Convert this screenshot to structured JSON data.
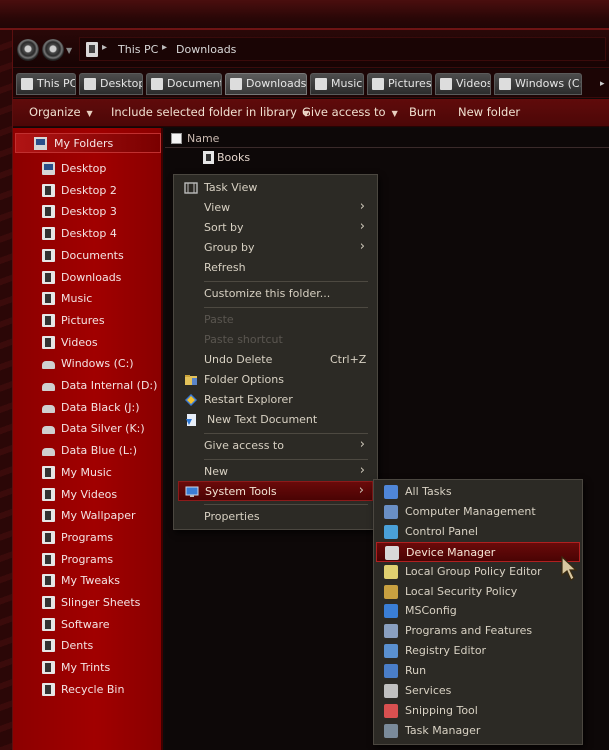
{
  "address": {
    "crumbs": [
      "This PC",
      "Downloads"
    ],
    "separator": "▸"
  },
  "tabs": [
    {
      "label": "This PC",
      "icon": "pc-icon"
    },
    {
      "label": "Desktop",
      "icon": "desktop-icon"
    },
    {
      "label": "Documents",
      "icon": "documents-icon"
    },
    {
      "label": "Downloads",
      "icon": "downloads-icon"
    },
    {
      "label": "Music",
      "icon": "music-icon"
    },
    {
      "label": "Pictures",
      "icon": "pictures-icon"
    },
    {
      "label": "Videos",
      "icon": "videos-icon"
    },
    {
      "label": "Windows (C:)",
      "icon": "drive-icon"
    }
  ],
  "tabs_more": "▸",
  "commands": {
    "organize": "Organize",
    "include": "Include selected folder in library",
    "give_access": "Give access to",
    "burn": "Burn",
    "new_folder": "New folder",
    "caret": "▼"
  },
  "nav": {
    "header": "My Folders",
    "items": [
      "Desktop",
      "Desktop 2",
      "Desktop 3",
      "Desktop 4",
      "Documents",
      "Downloads",
      "Music",
      "Pictures",
      "Videos",
      "Windows (C:)",
      "Data Internal (D:)",
      "Data Black (J:)",
      "Data Silver (K:)",
      "Data Blue (L:)",
      "My Music",
      "My Videos",
      "My Wallpaper",
      "Programs",
      "Programs",
      "My Tweaks",
      "Slinger Sheets",
      "Software",
      "Dents",
      "My Trints",
      "Recycle Bin"
    ]
  },
  "content": {
    "column_name": "Name",
    "files": [
      "Books"
    ]
  },
  "context_menu": {
    "task_view": "Task View",
    "view": "View",
    "sort_by": "Sort by",
    "group_by": "Group by",
    "refresh": "Refresh",
    "customize": "Customize this folder...",
    "paste": "Paste",
    "paste_shortcut": "Paste shortcut",
    "undo_delete": "Undo Delete",
    "undo_accel": "Ctrl+Z",
    "folder_options": "Folder Options",
    "restart_explorer": "Restart Explorer",
    "new_text_doc": "New Text Document",
    "give_access": "Give access to",
    "new": "New",
    "system_tools": "System Tools",
    "properties": "Properties",
    "arrow": "›"
  },
  "submenu": {
    "items": [
      "All Tasks",
      "Computer Management",
      "Control Panel",
      "Device Manager",
      "Local Group Policy Editor",
      "Local Security Policy",
      "MSConfig",
      "Programs and Features",
      "Registry Editor",
      "Run",
      "Services",
      "Snipping Tool",
      "Task Manager"
    ],
    "highlighted": "Device Manager"
  },
  "colors": {
    "accent": "#a10000",
    "menu_bg": "#2c2a25",
    "highlight": "#6a0a0a"
  }
}
